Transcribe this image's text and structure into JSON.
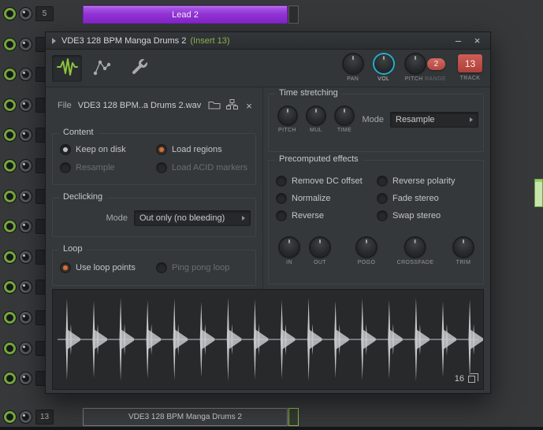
{
  "background": {
    "middle_rows": 12,
    "top_row": {
      "number": "5",
      "clip": "Lead 2"
    },
    "bottom_row": {
      "number": "13",
      "clip": "VDE3 128 BPM Manga Drums 2"
    }
  },
  "window": {
    "title": "VDE3 128 BPM Manga Drums 2",
    "subtitle": "(Insert 13)",
    "minimize": "–",
    "close": "×"
  },
  "toolbar": {
    "pan_label": "PAN",
    "vol_label": "VOL",
    "pitch_label": "PITCH",
    "range_label": "RANGE",
    "pitch_value": "2",
    "track_label": "TRACK",
    "track_value": "13"
  },
  "file": {
    "label": "File",
    "value": "VDE3 128 BPM..a Drums 2.wav"
  },
  "content": {
    "title": "Content",
    "keep_on_disk": "Keep on disk",
    "resample": "Resample",
    "load_regions": "Load regions",
    "load_acid": "Load ACID markers"
  },
  "declicking": {
    "title": "Declicking",
    "mode_label": "Mode",
    "mode_value": "Out only (no bleeding)"
  },
  "loop": {
    "title": "Loop",
    "use_loop_points": "Use loop points",
    "ping_pong": "Ping pong loop"
  },
  "time_stretching": {
    "title": "Time stretching",
    "knob_pitch": "PITCH",
    "knob_mul": "MUL",
    "knob_time": "TIME",
    "mode_label": "Mode",
    "mode_value": "Resample"
  },
  "precomputed": {
    "title": "Precomputed effects",
    "remove_dc": "Remove DC offset",
    "normalize": "Normalize",
    "reverse": "Reverse",
    "reverse_polarity": "Reverse polarity",
    "fade_stereo": "Fade stereo",
    "swap_stereo": "Swap stereo",
    "knob_in": "IN",
    "knob_out": "OUT",
    "knob_pogo": "POGO",
    "knob_crossfade": "CROSSFADE",
    "knob_trim": "TRIM"
  },
  "waveform": {
    "counter": "16",
    "hits": 16,
    "heights": [
      52,
      49,
      53,
      50,
      52,
      48,
      53,
      51,
      50,
      53,
      49,
      52,
      50,
      53,
      48,
      51
    ]
  }
}
